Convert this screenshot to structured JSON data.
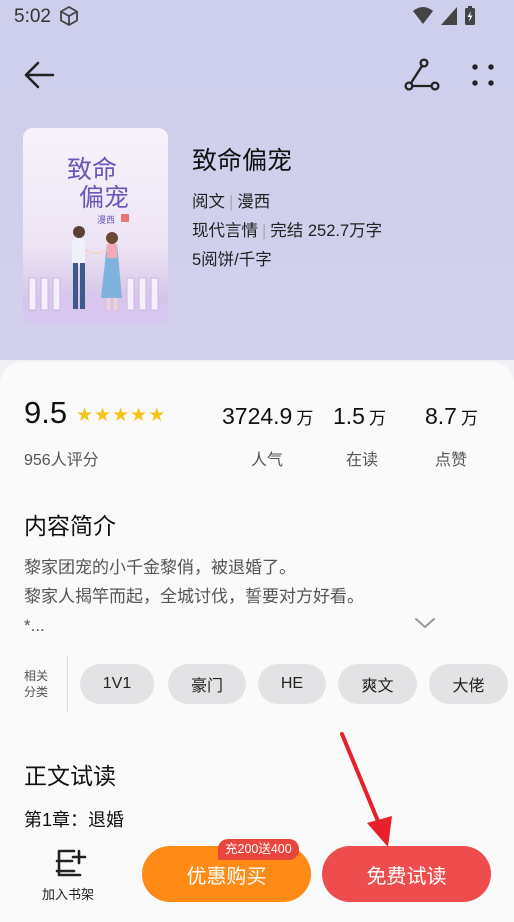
{
  "status_bar": {
    "time": "5:02"
  },
  "cover": {
    "title_line1": "致命",
    "title_line2": "偏宠",
    "author_stamp": "漫西"
  },
  "book": {
    "title": "致命偏宠",
    "publisher": "阅文",
    "author": "漫西",
    "genre": "现代言情",
    "status_words": "完结 252.7万字",
    "price": "5阅饼/千字"
  },
  "rating": {
    "score": "9.5",
    "stars": 5,
    "count_label": "956人评分"
  },
  "stats": [
    {
      "value": "3724.9",
      "unit": "万",
      "label": "人气"
    },
    {
      "value": "1.5",
      "unit": "万",
      "label": "在读"
    },
    {
      "value": "8.7",
      "unit": "万",
      "label": "点赞"
    }
  ],
  "synopsis": {
    "heading": "内容简介",
    "line1": "黎家团宠的小千金黎俏，被退婚了。",
    "line2": "黎家人揭竿而起，全城讨伐，誓要对方好看。",
    "line3": "*..."
  },
  "tags": {
    "label_line1": "相关",
    "label_line2": "分类",
    "items": [
      "1V1",
      "豪门",
      "HE",
      "爽文",
      "大佬"
    ]
  },
  "preview": {
    "heading": "正文试读",
    "chapter": "第1章：退婚"
  },
  "bottom_bar": {
    "add_shelf": "加入书架",
    "buy": "优惠购买",
    "promo": "充200送400",
    "free_read": "免费试读"
  },
  "colors": {
    "accent_orange": "#ff8a15",
    "accent_red": "#ef4d4d",
    "star": "#f6c317"
  }
}
